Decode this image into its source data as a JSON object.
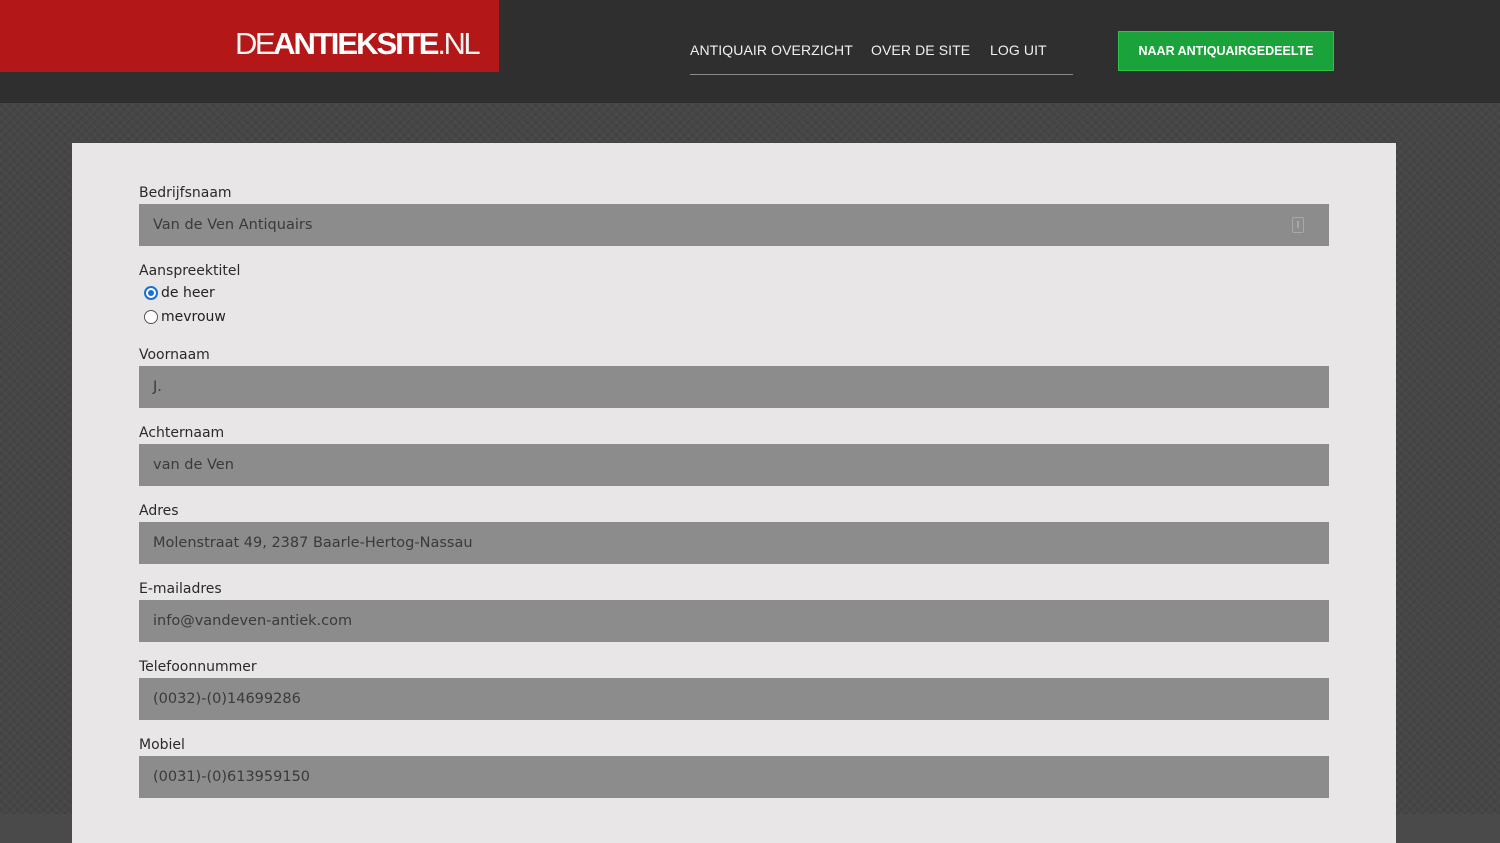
{
  "header": {
    "logo": {
      "part1": "DE",
      "part2": "ANTIEKSITE",
      "part3": ".NL"
    },
    "nav": [
      {
        "label": "ANTIQUAIR OVERZICHT"
      },
      {
        "label": "OVER DE SITE"
      },
      {
        "label": "LOG UIT"
      }
    ],
    "cta_label": "NAAR ANTIQUAIRGEDEELTE"
  },
  "form": {
    "bedrijfsnaam": {
      "label": "Bedrijfsnaam",
      "value": "Van de Ven Antiquairs"
    },
    "aanspreektitel": {
      "label": "Aanspreektitel",
      "options": [
        {
          "label": "de heer",
          "checked": true
        },
        {
          "label": "mevrouw",
          "checked": false
        }
      ]
    },
    "voornaam": {
      "label": "Voornaam",
      "value": "J."
    },
    "achternaam": {
      "label": "Achternaam",
      "value": "van de Ven"
    },
    "adres": {
      "label": "Adres",
      "value": "Molenstraat 49, 2387 Baarle-Hertog-Nassau"
    },
    "email": {
      "label": "E-mailadres",
      "value": "info@vandeven-antiek.com"
    },
    "telefoon": {
      "label": "Telefoonnummer",
      "value": "(0032)-(0)14699286"
    },
    "mobiel": {
      "label": "Mobiel",
      "value": "(0031)-(0)613959150"
    }
  },
  "colors": {
    "logo_bg": "#b31717",
    "header_bg": "#2f2f2f",
    "cta_bg": "#1aa33a",
    "field_bg": "#8c8c8c",
    "panel_bg": "#e8e6e6",
    "radio_accent": "#1a6fd6"
  }
}
